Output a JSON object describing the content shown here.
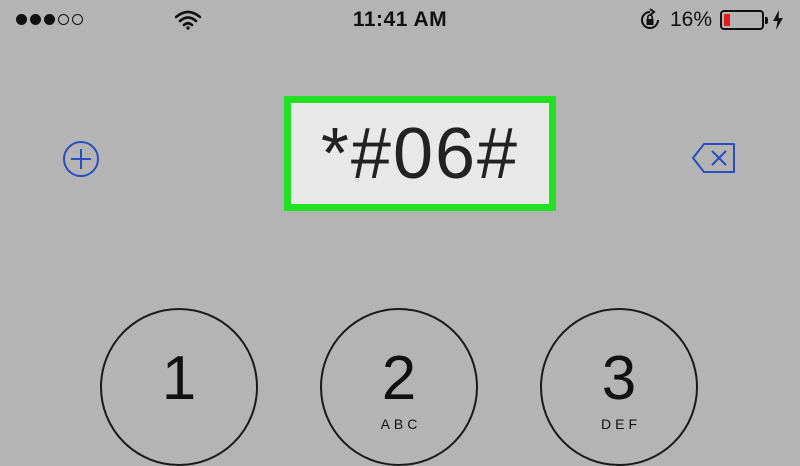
{
  "status_bar": {
    "signal_bars_filled": 3,
    "signal_bars_total": 5,
    "time": "11:41 AM",
    "battery_percent": "16%",
    "battery_level": 0.16,
    "icons": [
      "wifi-icon",
      "orientation-lock-icon",
      "charging-bolt-icon"
    ]
  },
  "dialer": {
    "entered_number": "*#06#",
    "add_contact_icon": "plus-circle-icon",
    "delete_icon": "backspace-icon"
  },
  "keypad": [
    {
      "digit": "1",
      "letters": ""
    },
    {
      "digit": "2",
      "letters": "ABC"
    },
    {
      "digit": "3",
      "letters": "DEF"
    }
  ],
  "colors": {
    "background": "#b4b4b4",
    "highlight_border": "#22e122",
    "accent_blue": "#2a4dbf",
    "battery_low": "#e01b1b"
  }
}
